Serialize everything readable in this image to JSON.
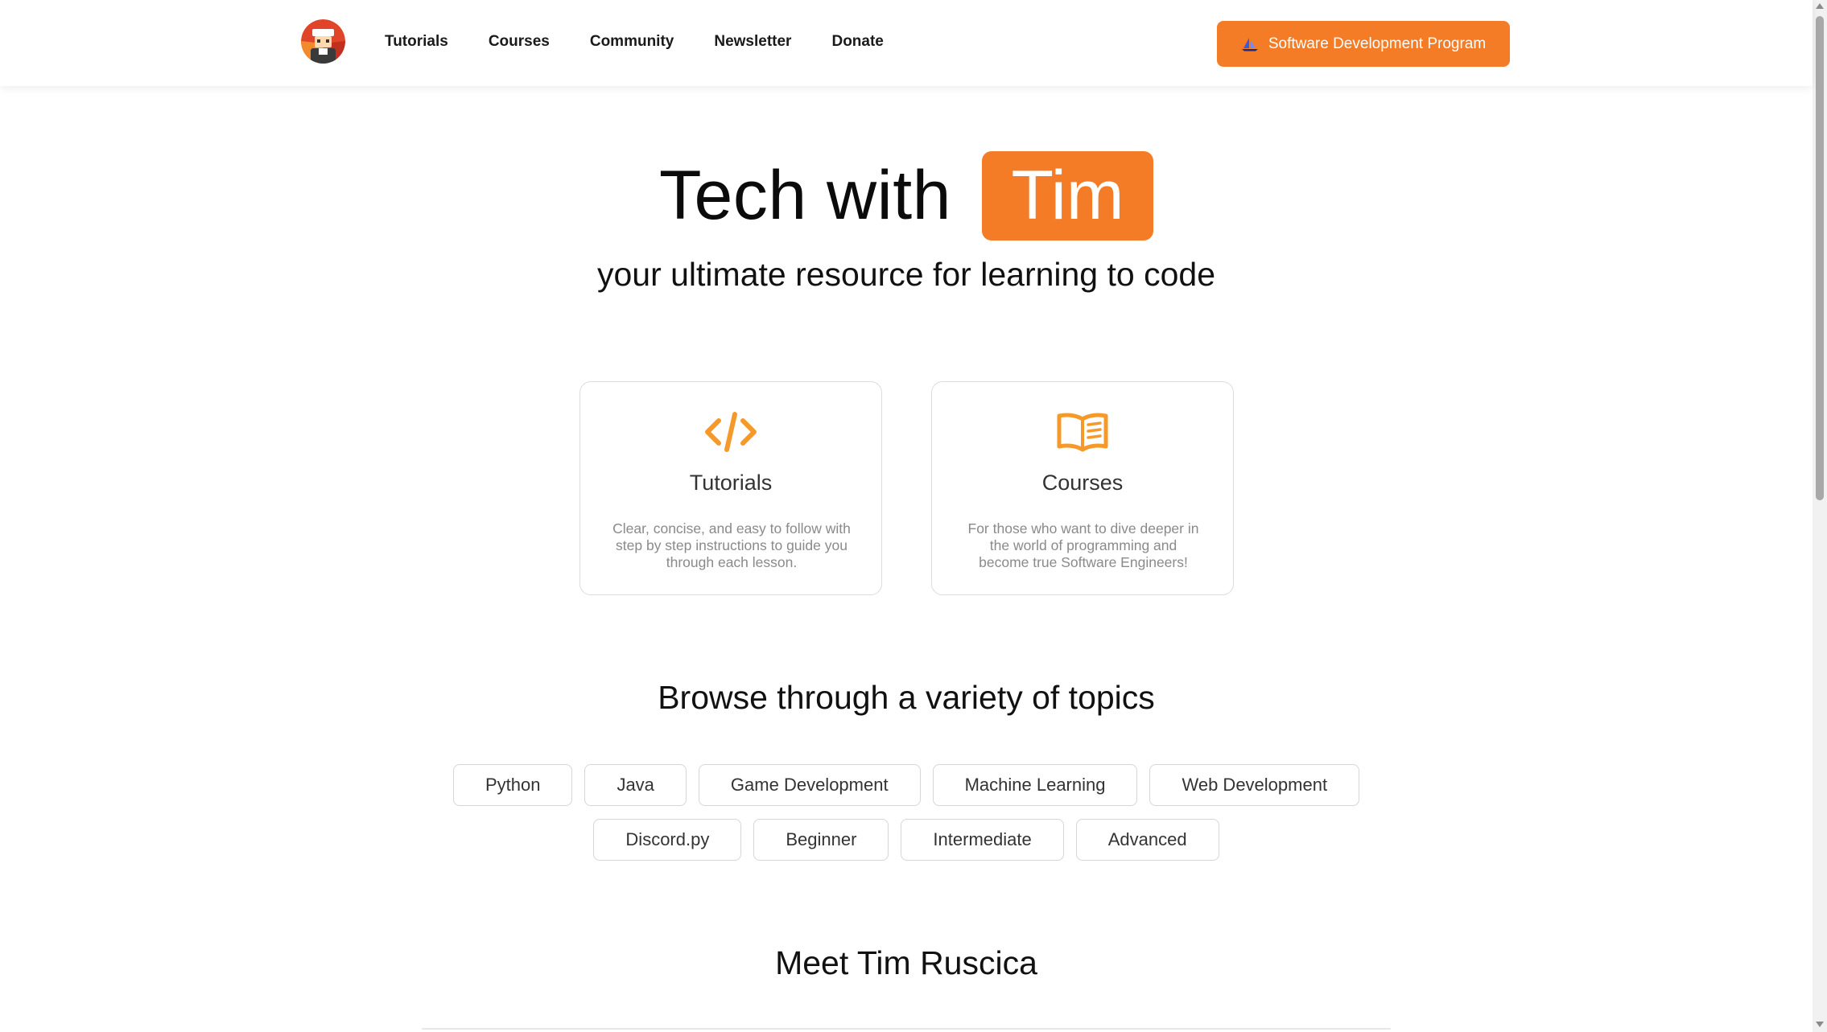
{
  "header": {
    "logo_icon": "robot-avatar-logo",
    "nav": [
      {
        "label": "Tutorials"
      },
      {
        "label": "Courses"
      },
      {
        "label": "Community"
      },
      {
        "label": "Newsletter"
      },
      {
        "label": "Donate"
      }
    ],
    "cta": {
      "label": "Software Development Program",
      "icon": "sail-icon"
    }
  },
  "hero": {
    "title_part1": "Tech with",
    "title_part2": "Tim",
    "subtitle": "your ultimate resource for learning to code"
  },
  "cards": [
    {
      "icon": "code-brackets-icon",
      "title": "Tutorials",
      "description": "Clear, concise, and easy to follow with step by step instructions to guide you through each lesson."
    },
    {
      "icon": "open-book-icon",
      "title": "Courses",
      "description": "For those who want to dive deeper in the world of programming and become true Software Engineers!"
    }
  ],
  "topics": {
    "heading": "Browse through a variety of topics",
    "items": [
      "Python",
      "Java",
      "Game Development",
      "Machine Learning",
      "Web Development",
      "Discord.py",
      "Beginner",
      "Intermediate",
      "Advanced"
    ]
  },
  "meet": {
    "heading": "Meet Tim Ruscica"
  },
  "colors": {
    "accent": "#f47c26",
    "icon_orange": "#f59a2a"
  }
}
